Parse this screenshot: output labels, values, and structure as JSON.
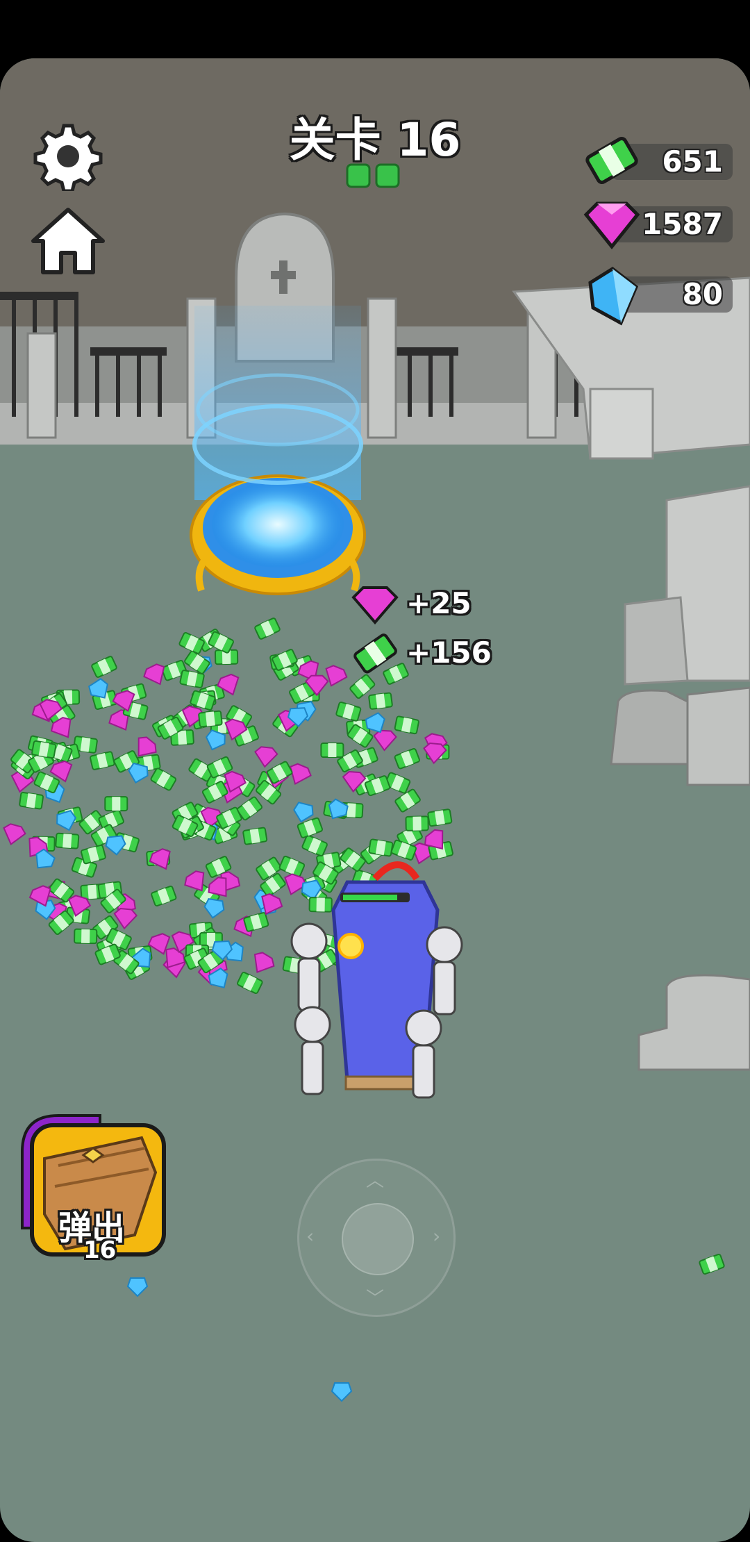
{
  "level": {
    "title": "关卡 16",
    "stage_pips": 2
  },
  "currencies": {
    "cash": {
      "value": "651",
      "icon": "cash-icon",
      "color": "#3fd14a"
    },
    "pink_gem": {
      "value": "1587",
      "icon": "pink-gem-icon",
      "color": "#e63fd4"
    },
    "blue_crystal": {
      "value": "80",
      "icon": "blue-crystal-icon",
      "color": "#3fb4f5"
    }
  },
  "rewards": [
    {
      "icon": "pink-gem-icon",
      "text": "+25"
    },
    {
      "icon": "cash-icon",
      "text": "+156"
    }
  ],
  "ability": {
    "label": "弹出",
    "count": "16",
    "icon": "coffin-icon"
  },
  "colors": {
    "ground": "#748a80",
    "sky": "#6e6a62",
    "portal": "#4fb8ff",
    "coffin": "#5a62e8"
  }
}
